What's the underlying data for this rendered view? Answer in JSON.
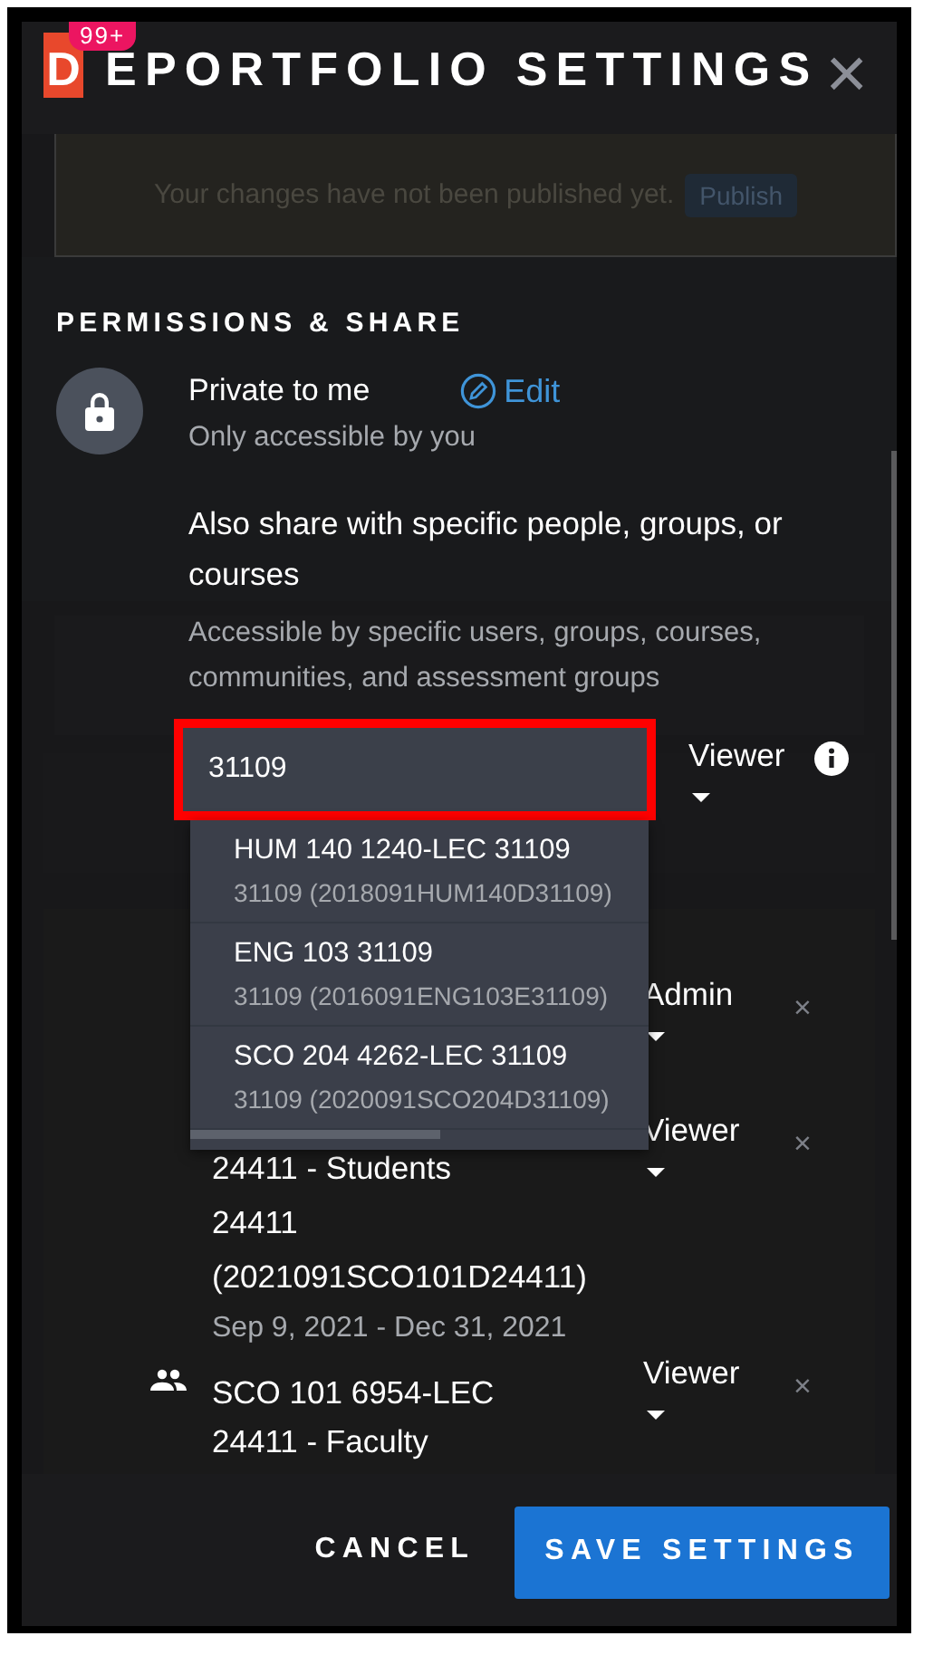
{
  "header": {
    "logo_letter": "D",
    "badge": "99+",
    "title": "EPORTFOLIO SETTINGS",
    "close": "×"
  },
  "background": {
    "notice": "Your changes have not been published yet.",
    "publish": "Publish"
  },
  "permissions": {
    "heading": "PERMISSIONS & SHARE",
    "visibility": {
      "title": "Private to me",
      "subtitle": "Only accessible by you",
      "edit": "Edit"
    },
    "share": {
      "title": "Also share with specific people, groups, or courses",
      "description": "Accessible by specific users, groups, courses, communities, and assessment groups",
      "search": {
        "value": "31109",
        "highlighted": true
      },
      "role": "Viewer"
    },
    "suggestions": [
      {
        "title": "HUM 140 1240-LEC 31109",
        "subtitle": "31109 (2018091HUM140D31109)",
        "selected": false
      },
      {
        "title": "ENG 103 31109",
        "subtitle": "31109 (2016091ENG103E31109)",
        "selected": false
      },
      {
        "title": "SCO 204 4262-LEC 31109",
        "subtitle": "31109 (2020091SCO204D31109)",
        "selected": false
      }
    ],
    "shares": [
      {
        "icon_shown": false,
        "role": "Admin",
        "remove": "×"
      },
      {
        "icon_shown": false,
        "lines": [
          "24411 - Students",
          "24411 (2021091SCO101D24411)"
        ],
        "dates": "Sep 9, 2021 - Dec 31, 2021",
        "role": "Viewer",
        "remove": "×"
      },
      {
        "icon_shown": true,
        "lines": [
          "SCO 101 6954-LEC",
          "24411 - Faculty"
        ],
        "role": "Viewer",
        "remove": "×"
      }
    ]
  },
  "footer": {
    "cancel": "CANCEL",
    "save": "SAVE SETTINGS"
  }
}
